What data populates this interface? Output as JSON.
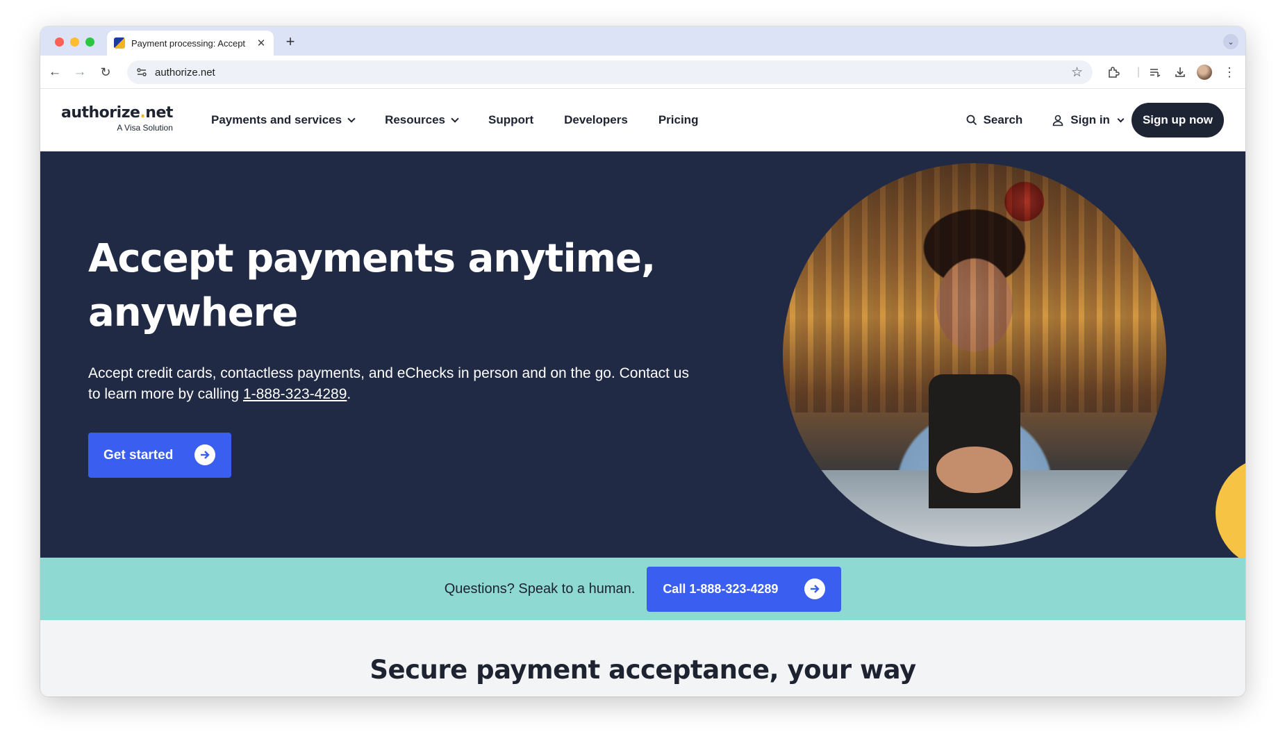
{
  "browser": {
    "tab_title": "Payment processing: Accept",
    "new_tab_glyph": "+",
    "close_glyph": "✕",
    "url": "authorize.net"
  },
  "site": {
    "logo": {
      "part1": "authorize",
      "dot": ".",
      "part2": "net",
      "sub": "A Visa Solution"
    },
    "nav": [
      {
        "label": "Payments and services",
        "has_dropdown": true
      },
      {
        "label": "Resources",
        "has_dropdown": true
      },
      {
        "label": "Support",
        "has_dropdown": false
      },
      {
        "label": "Developers",
        "has_dropdown": false
      },
      {
        "label": "Pricing",
        "has_dropdown": false
      }
    ],
    "search_label": "Search",
    "signin_label": "Sign in",
    "signup_label": "Sign up now"
  },
  "hero": {
    "title_line1": "Accept payments anytime,",
    "title_line2": "anywhere",
    "desc_before": "Accept credit cards, contactless payments, and eChecks in person and on the go. Contact us to learn more by calling ",
    "desc_phone": "1-888-323-4289",
    "desc_after": ".",
    "cta_label": "Get started"
  },
  "callbar": {
    "text": "Questions? Speak to a human.",
    "button_label": "Call 1-888-323-4289"
  },
  "section": {
    "title": "Secure payment acceptance, your way"
  },
  "colors": {
    "hero_bg": "#212a45",
    "accent_blue": "#3a5ff0",
    "callbar_bg": "#8ed9d1",
    "logo_dot": "#f0b323",
    "decor_yellow": "#f6c344"
  }
}
